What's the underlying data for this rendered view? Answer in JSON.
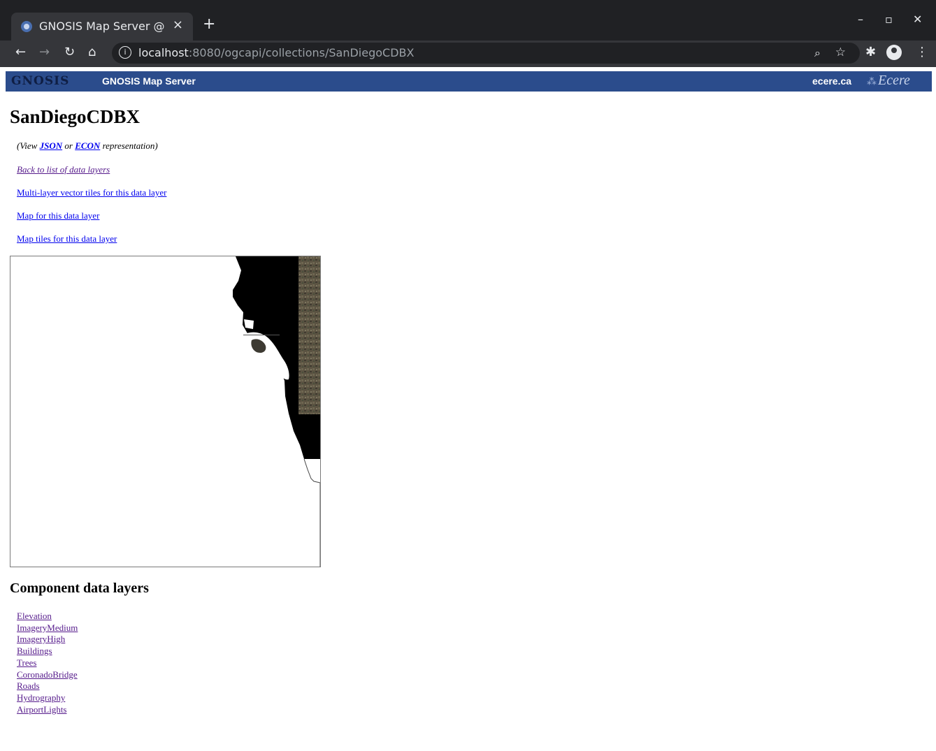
{
  "browser": {
    "tab_title": "GNOSIS Map Server @",
    "tab_close": "×",
    "new_tab": "+",
    "url_host": "localhost",
    "url_rest": ":8080/ogcapi/collections/SanDiegoCDBX",
    "icons": [
      "back-icon",
      "forward-icon",
      "reload-icon",
      "home-icon",
      "info-icon",
      "zoom-icon",
      "star-icon",
      "extensions-icon",
      "profile-icon",
      "menu-icon"
    ]
  },
  "banner": {
    "logo_text": "GNOSIS",
    "server_name": "GNOSIS Map Server",
    "ecere_link": "ecere.ca",
    "ecere_logo": "Ecere"
  },
  "page": {
    "title": "SanDiegoCDBX",
    "view_prefix": "(View ",
    "json_link": "JSON",
    "view_or": " or ",
    "econ_link": "ECON",
    "view_suffix": " representation)",
    "back_link": "Back to list of data layers",
    "vector_tiles_link": "Multi-layer vector tiles for this data layer",
    "map_link": "Map for this data layer",
    "map_tiles_link": "Map tiles for this data layer",
    "components_heading": "Component data layers",
    "components": [
      "Elevation",
      "ImageryMedium",
      "ImageryHigh",
      "Buildings",
      "Trees",
      "CoronadoBridge",
      "Roads",
      "Hydrography",
      "AirportLights"
    ]
  }
}
